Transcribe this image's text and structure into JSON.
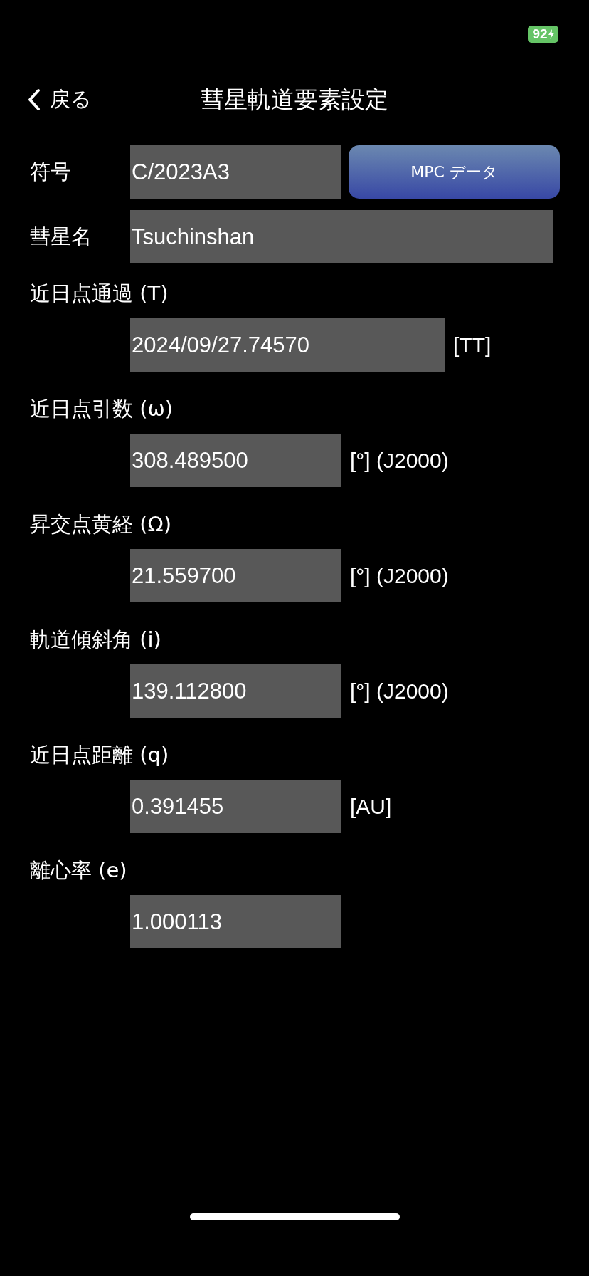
{
  "status_bar": {
    "battery": "92"
  },
  "nav": {
    "back": "戻る",
    "title": "彗星軌道要素設定"
  },
  "identity": [
    {
      "label": "符号",
      "value": "C/2023A3",
      "kind": "short"
    },
    {
      "label": "彗星名",
      "value": "Tsuchinshan",
      "kind": "full"
    }
  ],
  "mpc_button": "MPC データ",
  "elements": [
    {
      "label": "近日点通過 (T)",
      "value": "2024/09/27.74570",
      "unit": "[TT]",
      "kind": "wide"
    },
    {
      "label": "近日点引数 (ω)",
      "value": "308.489500",
      "unit": "[°] (J2000)",
      "kind": "short"
    },
    {
      "label": "昇交点黄経 (Ω)",
      "value": "21.559700",
      "unit": "[°] (J2000)",
      "kind": "short"
    },
    {
      "label": "軌道傾斜角 (i)",
      "value": "139.112800",
      "unit": "[°] (J2000)",
      "kind": "short"
    },
    {
      "label": "近日点距離 (q)",
      "value": "0.391455",
      "unit": "[AU]",
      "kind": "short"
    },
    {
      "label": "離心率 (e)",
      "value": "1.000113",
      "kind": "short"
    }
  ]
}
